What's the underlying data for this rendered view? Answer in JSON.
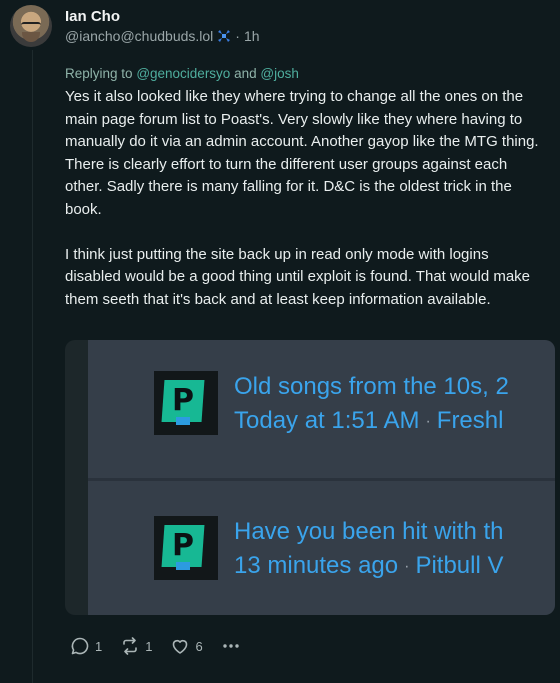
{
  "post": {
    "author": {
      "display_name": "Ian Cho",
      "handle": "@iancho@chudbuds.lol",
      "verified_icon": "sparkle-badge-icon",
      "time_sep": "·",
      "time": "1h"
    },
    "reply": {
      "prefix": "Replying to",
      "mention1": "@genocidersyo",
      "conj": "and",
      "mention2": "@josh"
    },
    "paragraphs": [
      "Yes it also looked like they where trying to change all the ones on the main page forum list to Poast's. Very slowly like they where having to manually do it via an admin account. Another gayop like the MTG thing. There is clearly effort to turn the different user groups against each other. Sadly there is many falling for it. D&C is the oldest trick in the book.",
      "I think just putting the site back up in read only mode with logins disabled would be a good thing until exploit is found. That would make them seeth that it's back and at least keep information available."
    ],
    "attachment": {
      "items": [
        {
          "title": "Old songs from the 10s, 2",
          "time": "Today at 1:51 AM",
          "sep": "·",
          "forum": "Freshl"
        },
        {
          "title": "Have you been hit with th",
          "time": "13 minutes ago",
          "sep": "·",
          "forum": "Pitbull V"
        }
      ]
    },
    "actions": {
      "replies": "1",
      "reposts": "1",
      "likes": "6"
    },
    "colors": {
      "background": "#0f1a1d",
      "accent": "#4fae9e",
      "link_blue": "#3aa4ec",
      "logo_green": "#17b894"
    }
  }
}
